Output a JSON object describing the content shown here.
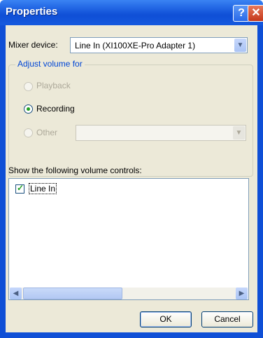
{
  "window": {
    "title": "Properties"
  },
  "titlebar": {
    "help_glyph": "?",
    "close_glyph": "✕"
  },
  "mixer": {
    "label": "Mixer device:",
    "value": "Line In (XI100XE-Pro Adapter 1)",
    "arrow_icon": "chevron-down-icon"
  },
  "adjust": {
    "group_label": "Adjust volume for",
    "options": [
      {
        "label": "Playback",
        "selected": false,
        "enabled": false
      },
      {
        "label": "Recording",
        "selected": true,
        "enabled": true
      },
      {
        "label": "Other",
        "selected": false,
        "enabled": false
      }
    ],
    "other_combo_value": ""
  },
  "controls": {
    "label": "Show the following volume controls:",
    "items": [
      {
        "label": "Line In",
        "checked": true
      }
    ]
  },
  "buttons": {
    "ok": "OK",
    "cancel": "Cancel"
  },
  "colors": {
    "titlebar": "#0f4fd6",
    "dialog_bg": "#ece9d8",
    "group_label": "#0046d5",
    "check_green": "#21a121"
  }
}
